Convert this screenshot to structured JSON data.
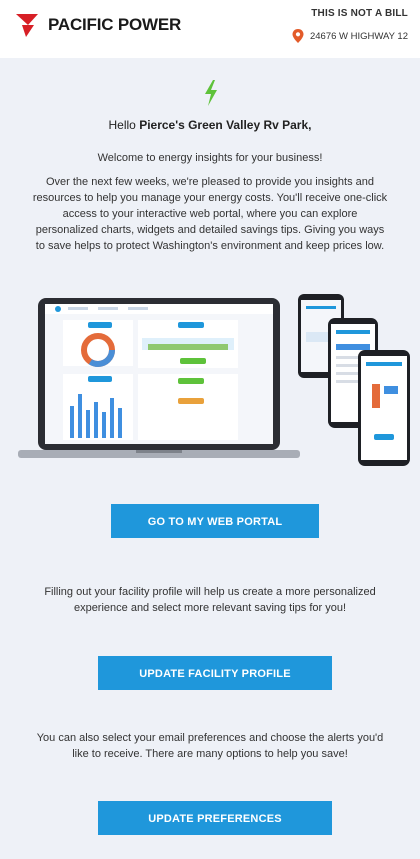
{
  "header": {
    "brand": "PACIFIC POWER",
    "notice": "THIS IS NOT A BILL",
    "address": "24676 W HIGHWAY 12",
    "brand_color": "#d71f26"
  },
  "greeting": {
    "prefix": "Hello ",
    "name": "Pierce's Green Valley Rv Park,"
  },
  "welcome": "Welcome to energy insights for your business!",
  "intro": "Over the next few weeks, we're pleased to provide you insights and resources to help you manage your energy costs. You'll receive one-click access to your interactive web portal, where you can explore personalized charts, widgets and detailed savings tips. Giving you ways to save helps to protect Washington's environment and keep prices low.",
  "portal_button": "GO TO MY WEB PORTAL",
  "facility_text": "Filling out your facility profile will help us create a more personalized experience and select more relevant saving tips for you!",
  "facility_button": "UPDATE FACILITY PROFILE",
  "preferences_text": "You can also select your email preferences and choose the alerts you'd like to receive. There are many options to help you save!",
  "preferences_button": "UPDATE PREFERENCES",
  "icons": [
    "pacific-power-logo-icon",
    "location-pin-icon",
    "lightning-bolt-icon"
  ],
  "colors": {
    "accent": "#1f97db",
    "bolt": "#5ec23a",
    "pin": "#e35b2a",
    "background": "#eef1f7"
  }
}
